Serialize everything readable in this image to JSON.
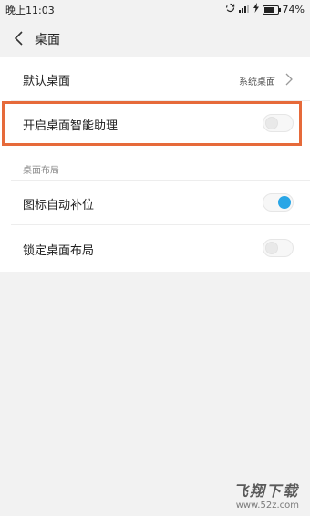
{
  "status_bar": {
    "time": "晚上11:03",
    "battery_text": "74%",
    "battery_level": 0.74
  },
  "app_bar": {
    "title": "桌面"
  },
  "settings": {
    "default_desktop": {
      "label": "默认桌面",
      "value": "系统桌面"
    },
    "smart_assistant": {
      "label": "开启桌面智能助理",
      "enabled": false
    },
    "section_layout": {
      "label": "桌面布局"
    },
    "auto_fill_icons": {
      "label": "图标自动补位",
      "enabled": true
    },
    "lock_layout": {
      "label": "锁定桌面布局",
      "enabled": false
    }
  },
  "watermark": {
    "brand": "飞翔下载",
    "url": "www.52z.com"
  },
  "colors": {
    "accent": "#2aa6e6",
    "highlight": "#e66a3a"
  },
  "icons": [
    "sync-icon",
    "signal-icon",
    "charging-icon",
    "battery-icon",
    "back-chevron-icon",
    "chevron-right-icon"
  ]
}
